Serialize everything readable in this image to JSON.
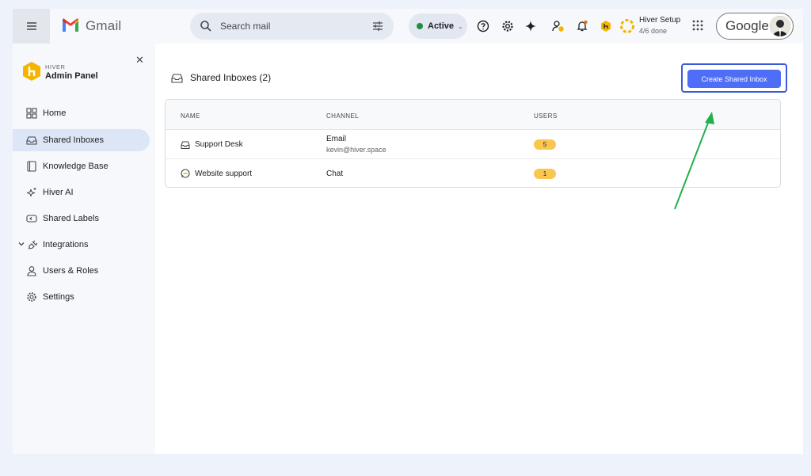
{
  "topbar": {
    "app_name": "Gmail",
    "search_placeholder": "Search mail",
    "status_label": "Active",
    "setup_title": "Hiver Setup",
    "setup_progress": "4/6 done",
    "account_brand": "Google"
  },
  "sidebar": {
    "brand_small": "HIVER",
    "brand_title": "Admin Panel",
    "items": [
      {
        "label": "Home",
        "icon": "grid-icon"
      },
      {
        "label": "Shared Inboxes",
        "icon": "inbox-icon",
        "active": true
      },
      {
        "label": "Knowledge Base",
        "icon": "book-icon"
      },
      {
        "label": "Hiver AI",
        "icon": "sparkle-icon"
      },
      {
        "label": "Shared Labels",
        "icon": "label-icon"
      },
      {
        "label": "Integrations",
        "icon": "plug-icon",
        "expandable": true
      },
      {
        "label": "Users & Roles",
        "icon": "user-icon"
      },
      {
        "label": "Settings",
        "icon": "gear-icon"
      }
    ]
  },
  "main": {
    "title": "Shared Inboxes (2)",
    "create_button": "Create Shared Inbox",
    "columns": [
      "NAME",
      "CHANNEL",
      "USERS"
    ],
    "rows": [
      {
        "name": "Support Desk",
        "channel": "Email",
        "channel_detail": "kevin@hiver.space",
        "users": "5",
        "icon": "inbox-icon"
      },
      {
        "name": "Website support",
        "channel": "Chat",
        "channel_detail": "",
        "users": "1",
        "icon": "chat-icon"
      }
    ]
  },
  "colors": {
    "accent": "#4f6ef7",
    "active_nav": "#dde6f7",
    "badge": "#f9c74f",
    "status_dot": "#1e8e3e",
    "annotation_arrow": "#22b14c"
  }
}
